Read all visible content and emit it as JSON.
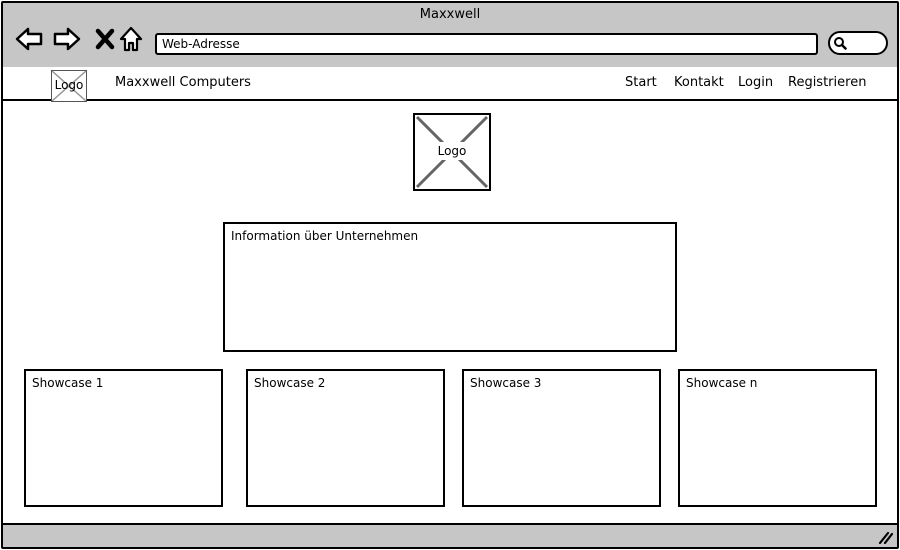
{
  "window": {
    "title": "Maxxwell"
  },
  "browser": {
    "back_icon": "arrow-left-icon",
    "forward_icon": "arrow-right-icon",
    "stop_icon": "close-icon",
    "home_icon": "home-icon",
    "address_value": "Web-Adresse",
    "search_icon": "search-icon"
  },
  "navbar": {
    "logo_label": "Logo",
    "brand": "Maxxwell Computers",
    "links": [
      "Start",
      "Kontakt",
      "Login",
      "Registrieren"
    ]
  },
  "main": {
    "logo_label": "Logo",
    "info_title": "Information über Unternehmen",
    "showcases": [
      "Showcase 1",
      "Showcase 2",
      "Showcase 3",
      "Showcase n"
    ]
  },
  "statusbar": {
    "grip_icon": "resize-grip-icon"
  }
}
